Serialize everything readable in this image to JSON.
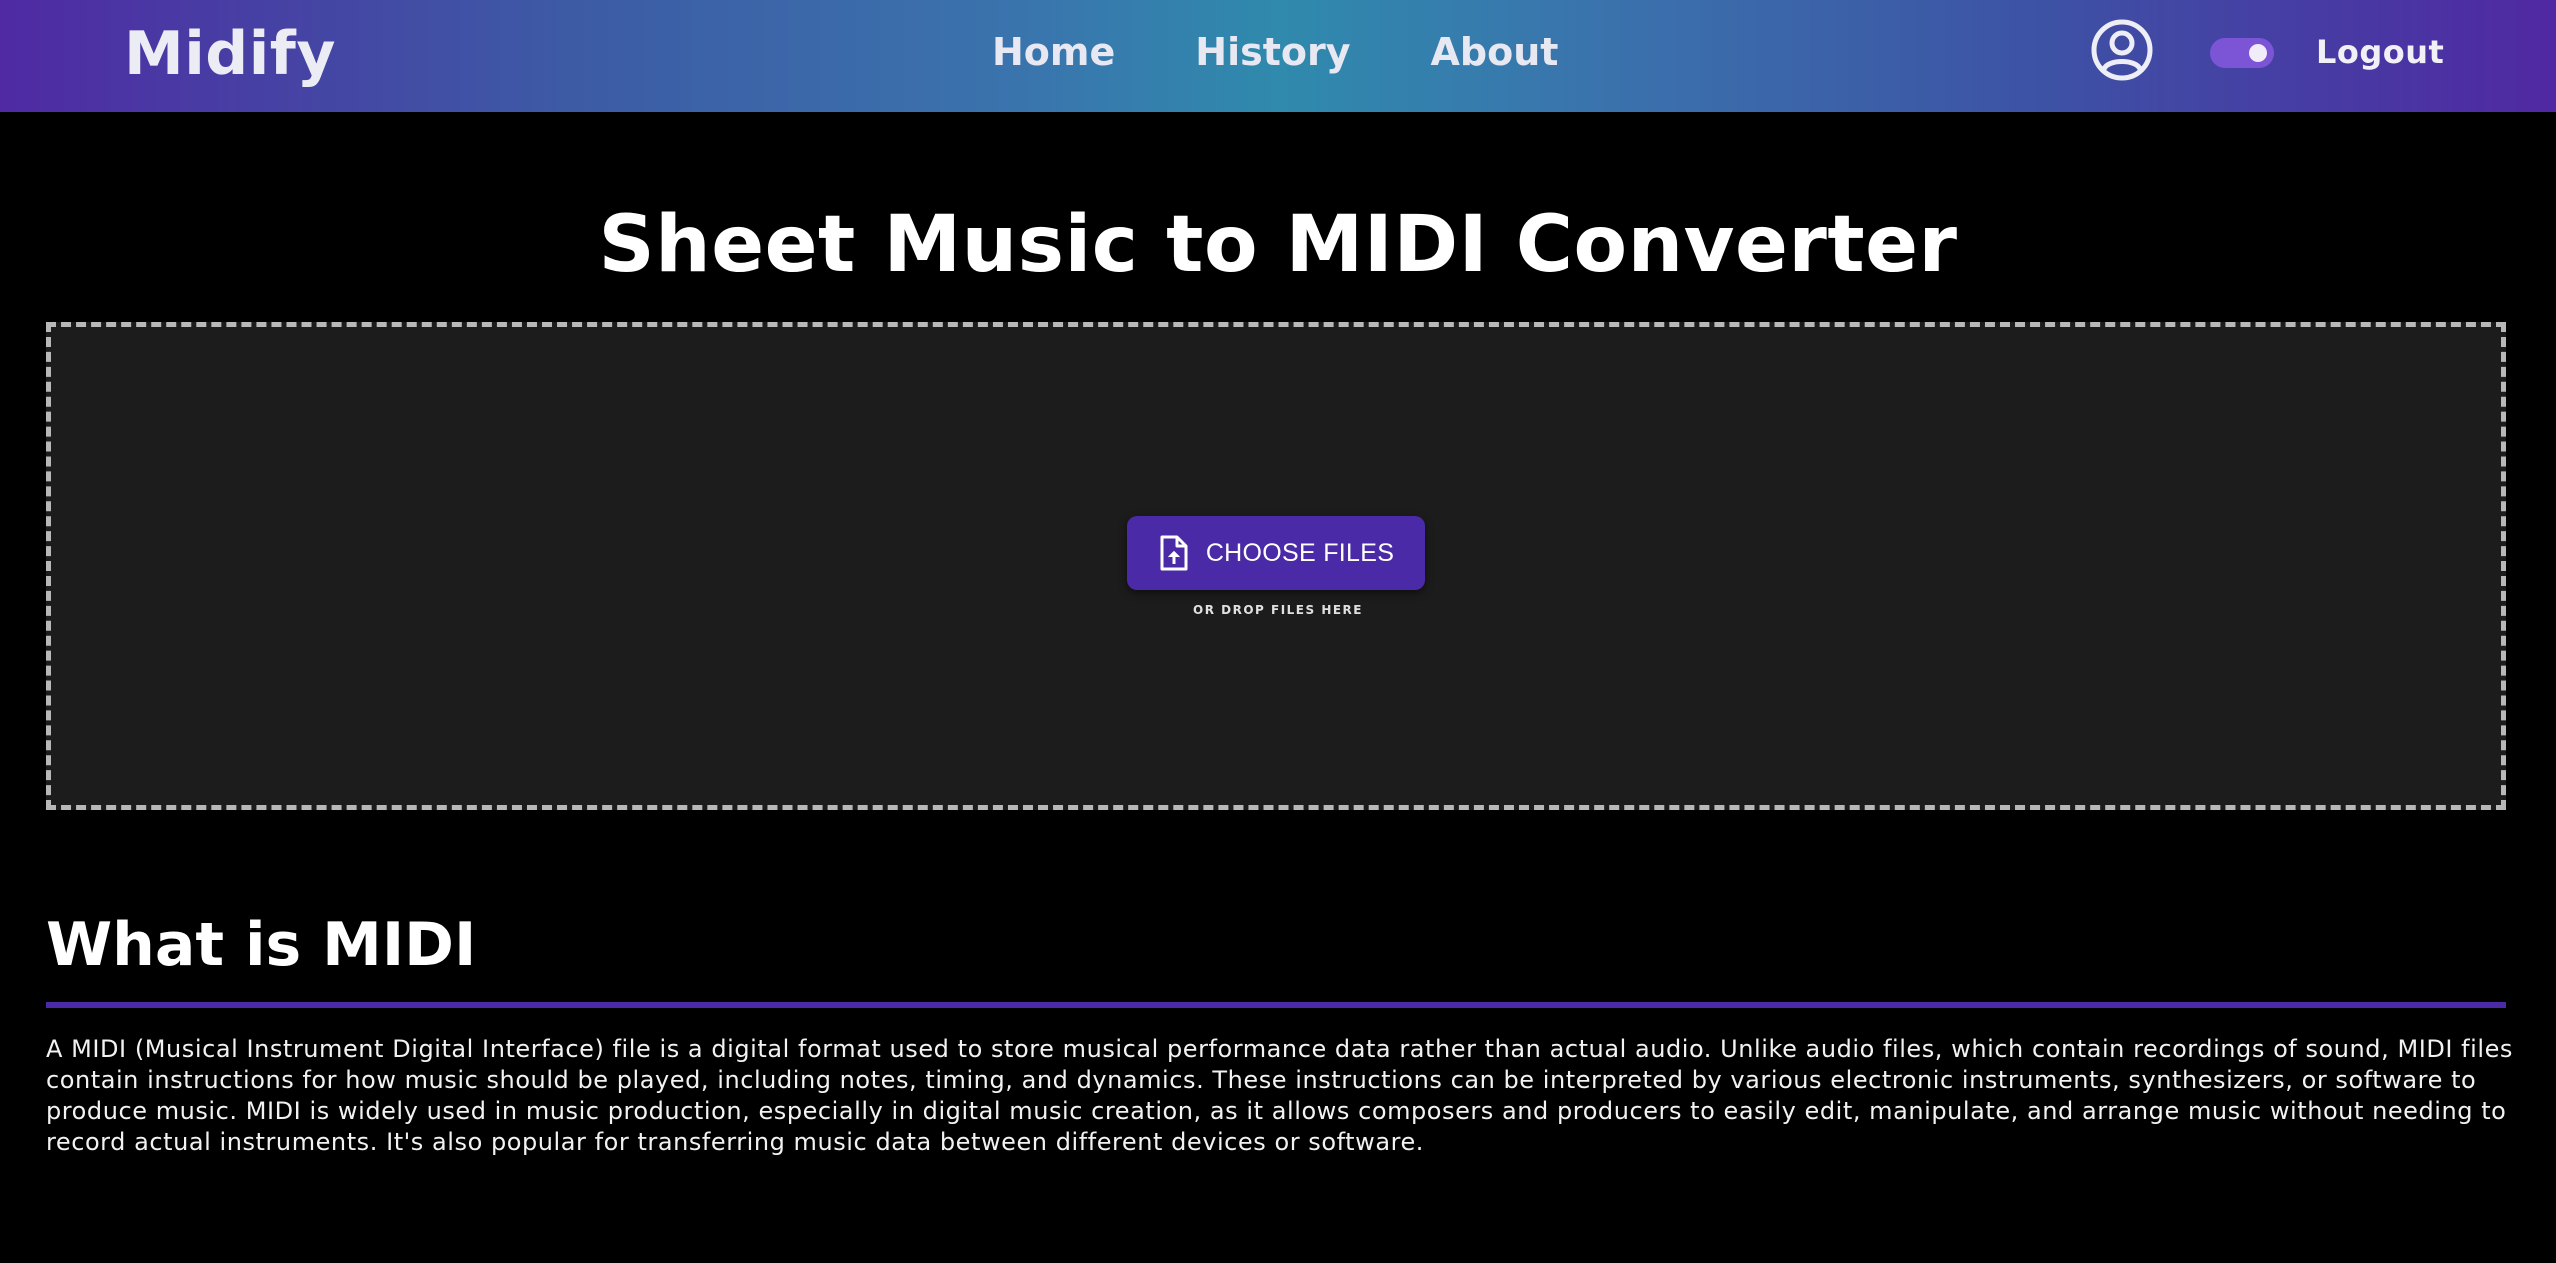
{
  "navbar": {
    "brand": "Midify",
    "links": [
      "Home",
      "History",
      "About"
    ],
    "profile_icon": "user-circle-icon",
    "theme_toggle": {
      "state": "on",
      "color": "#7b55d6"
    },
    "logout_label": "Logout"
  },
  "main": {
    "title": "Sheet Music to MIDI Converter",
    "upload": {
      "button_label": "CHOOSE FILES",
      "button_icon": "file-upload-icon",
      "hint": "OR DROP FILES HERE"
    }
  },
  "about_section": {
    "title": "What is MIDI",
    "body": "A MIDI (Musical Instrument Digital Interface) file is a digital format used to store musical performance data rather than actual audio. Unlike audio files, which contain recordings of sound, MIDI files contain instructions for how music should be played, including notes, timing, and dynamics. These instructions can be interpreted by various electronic instruments, synthesizers, or software to produce music. MIDI is widely used in music production, especially in digital music creation, as it allows composers and producers to easily edit, manipulate, and arrange music without needing to record actual instruments. It's also popular for transferring music data between different devices or software."
  },
  "colors": {
    "accent": "#4a2aa6",
    "background": "#000000",
    "dropzone_background": "#1c1c1c"
  }
}
